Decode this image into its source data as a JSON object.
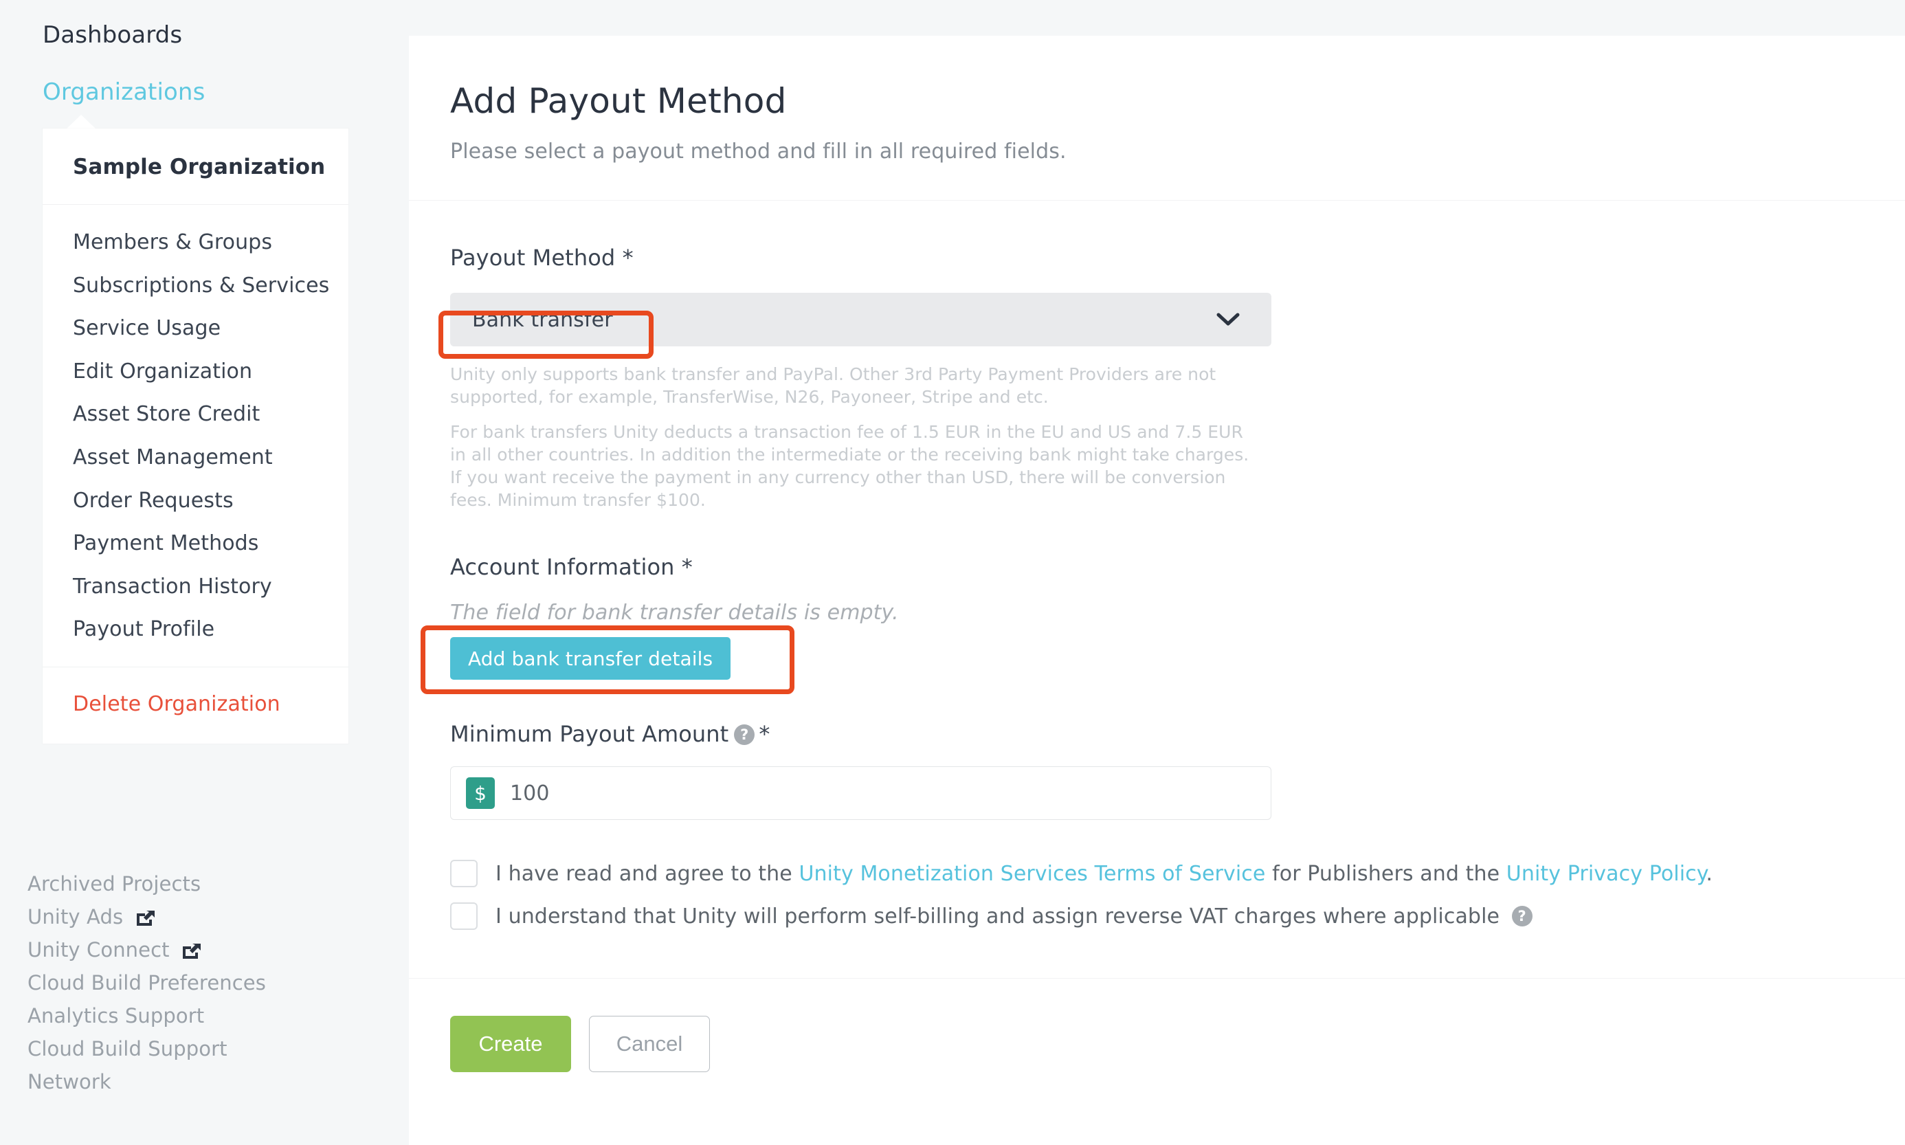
{
  "sidebar": {
    "dashboards_label": "Dashboards",
    "organizations_label": "Organizations",
    "org_title": "Sample Organization",
    "menu_items": [
      {
        "label": "Members & Groups"
      },
      {
        "label": "Subscriptions & Services"
      },
      {
        "label": "Service Usage"
      },
      {
        "label": "Edit Organization"
      },
      {
        "label": "Asset Store Credit"
      },
      {
        "label": "Asset Management"
      },
      {
        "label": "Order Requests"
      },
      {
        "label": "Payment Methods"
      },
      {
        "label": "Transaction History"
      },
      {
        "label": "Payout Profile"
      }
    ],
    "danger_label": "Delete Organization",
    "footer_links": [
      {
        "label": "Archived Projects",
        "external": false
      },
      {
        "label": "Unity Ads",
        "external": true
      },
      {
        "label": "Unity Connect",
        "external": true
      },
      {
        "label": "Cloud Build Preferences",
        "external": false
      },
      {
        "label": "Analytics Support",
        "external": false
      },
      {
        "label": "Cloud Build Support",
        "external": false
      },
      {
        "label": "Network",
        "external": false
      }
    ]
  },
  "main": {
    "title": "Add Payout Method",
    "subtitle": "Please select a payout method and fill in all required fields.",
    "payout_method": {
      "label": "Payout Method *",
      "selected": "Bank transfer",
      "chevron_icon": "chevron-down-icon",
      "helper_1": "Unity only supports bank transfer and PayPal. Other 3rd Party Payment Providers are not supported, for example, TransferWise, N26, Payoneer, Stripe and etc.",
      "helper_2": "For bank transfers Unity deducts a transaction fee of 1.5 EUR in the EU and US and 7.5 EUR in all other countries. In addition the intermediate or the receiving bank might take charges. If you want receive the payment in any currency other than USD, there will be conversion fees. Minimum transfer $100."
    },
    "account_information": {
      "label": "Account Information *",
      "empty_message": "The field for bank transfer details is empty.",
      "add_button_label": "Add bank transfer details"
    },
    "minimum_payout": {
      "label": "Minimum Payout Amount",
      "help_icon_glyph": "?",
      "required_star": "*",
      "currency_symbol": "$",
      "value": "100"
    },
    "agreements": [
      {
        "text_before": "I have read and agree to the ",
        "link_1": "Unity Monetization Services Terms of Service",
        "text_middle": " for Publishers and the ",
        "link_2": "Unity Privacy Policy",
        "text_after": ".",
        "checked": false
      },
      {
        "text_before": "I understand that Unity will perform self-billing and assign reverse VAT charges where applicable ",
        "help_icon_glyph": "?",
        "checked": false
      }
    ],
    "footer_buttons": {
      "create_label": "Create",
      "cancel_label": "Cancel"
    }
  },
  "annotations": {
    "color": "#e8491f",
    "boxes": [
      {
        "target": "payout-method-select"
      },
      {
        "target": "add-bank-transfer-details-button"
      }
    ]
  },
  "colors": {
    "page_background": "#f5f7f8",
    "panel_background": "#ffffff",
    "link_accent": "#5fc8e0",
    "danger": "#e8503a",
    "primary_button": "#4ebfd4",
    "create_button": "#92c353",
    "currency_badge": "#2e9e8a",
    "annotation": "#e8491f"
  }
}
